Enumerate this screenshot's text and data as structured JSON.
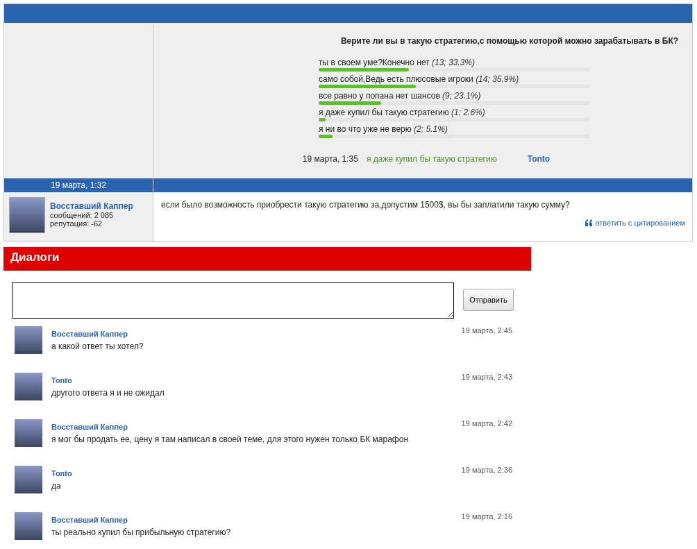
{
  "poll": {
    "question": "Верите ли вы в такую стратегию,с помощью которой можно зарабатывать в БК?",
    "options": [
      {
        "label": "ты в своем уме?Конечно нет",
        "result": "(13; 33.3%)",
        "level": 0.333
      },
      {
        "label": "само собой,Ведь есть плюсовые игроки",
        "result": "(14; 35.9%)",
        "level": 0.359
      },
      {
        "label": "все равно у попана нет шансов",
        "result": "(9; 23.1%)",
        "level": 0.231
      },
      {
        "label": "я даже купил бы такую стратегию",
        "result": "(1; 2.6%)",
        "level": 0.026
      },
      {
        "label": "я ни во что уже не верю",
        "result": "(2; 5.1%)",
        "level": 0.051
      }
    ],
    "last_vote": {
      "time": "19 марта, 1:35",
      "choice": "я даже купил бы такую стратегию",
      "user": "Tonto"
    }
  },
  "post": {
    "time": "19 марта, 1:32",
    "author": "Восставший Каппер",
    "messages_count": "сообщений: 2 085",
    "reputation": "репутация: -62",
    "text": "если было возможность приобрести такую стратегию за,допустим 1500$, вы бы заплатили такую сумму?",
    "quote_link": "ответить с цитированием"
  },
  "dialogs": {
    "title": "Диалоги",
    "send_button": "Отправить",
    "messages": [
      {
        "author": "Восставший Каппер",
        "time": "19 марта, 2:45",
        "text": "а какой ответ ты хотел?"
      },
      {
        "author": "Tonto",
        "time": "19 марта, 2:43",
        "text": "другого ответа я и не ожидал"
      },
      {
        "author": "Восставший Каппер",
        "time": "19 марта, 2:42",
        "text": "я мог бы продать ее, цену я там написал в своей теме, для этого нужен только БК марафон"
      },
      {
        "author": "Tonto",
        "time": "19 марта, 2:36",
        "text": "да"
      },
      {
        "author": "Восставший Каппер",
        "time": "19 марта, 2:16",
        "text": "ты реально купил бы прибыльную стратегию?"
      }
    ]
  }
}
